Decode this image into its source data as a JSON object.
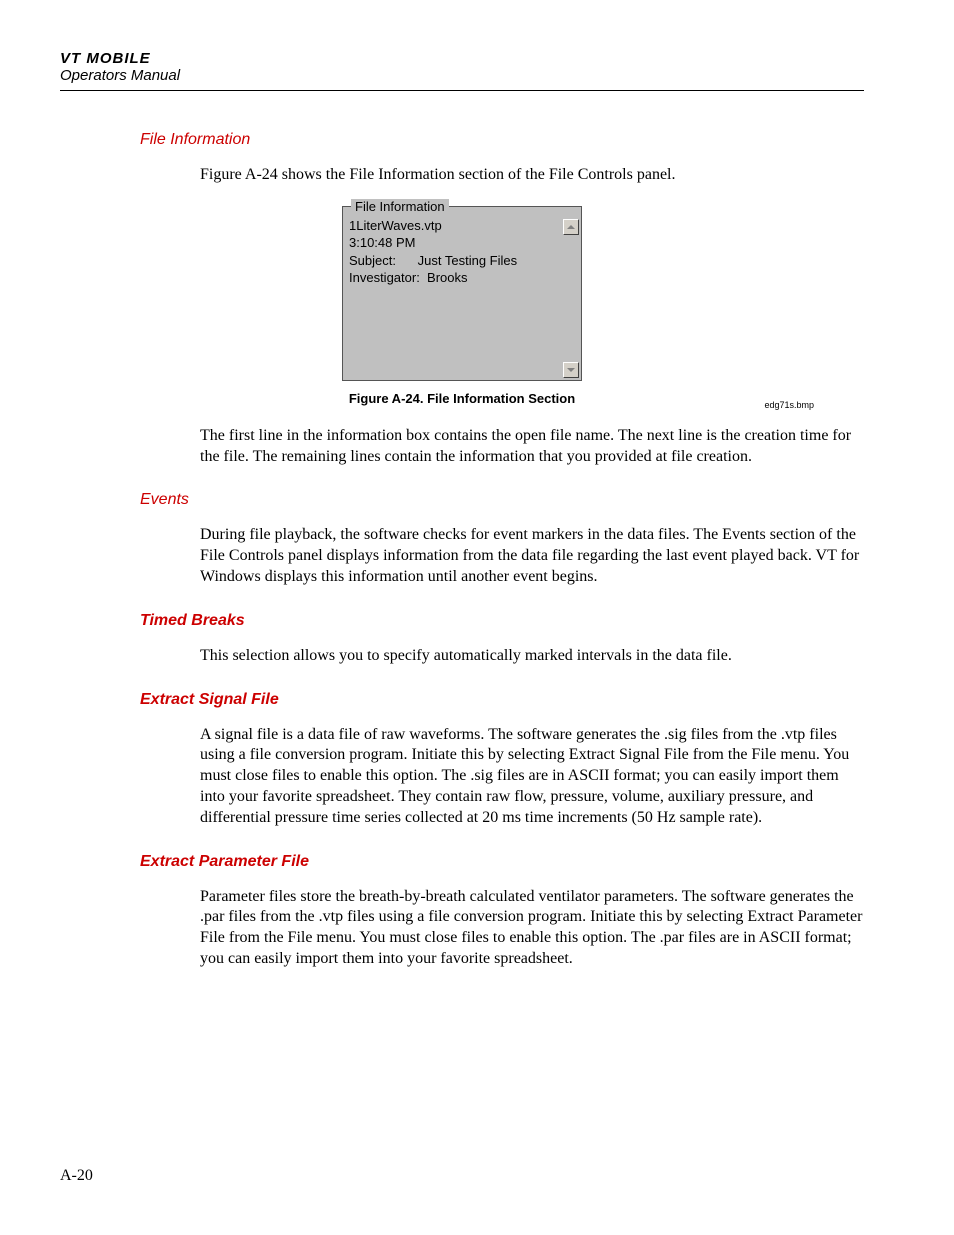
{
  "header": {
    "title": "VT MOBILE",
    "subtitle": "Operators Manual"
  },
  "sections": {
    "file_info": {
      "heading": "File Information",
      "intro": "Figure A-24 shows the File Information section of the File Controls panel.",
      "body": "The first line in the information box contains the open file name. The next line is the creation time for the file. The remaining lines contain the information that you provided at file creation."
    },
    "events": {
      "heading": "Events",
      "body": "During file playback, the software checks for event markers in the data files. The Events section of the File Controls panel displays information from the data file regarding the last event played back. VT for Windows displays this information until another event begins."
    },
    "timed_breaks": {
      "heading": "Timed Breaks",
      "body": "This selection allows you to specify automatically marked intervals in the data file."
    },
    "extract_signal": {
      "heading": "Extract Signal File",
      "body": "A signal file is a data file of raw waveforms. The software generates the .sig files from the .vtp files using a file conversion program. Initiate this by selecting Extract Signal File from the File menu. You must close files to enable this option. The .sig files are in ASCII format; you can easily import them into your favorite spreadsheet. They contain raw flow, pressure, volume, auxiliary pressure, and differential pressure time series collected at 20 ms time increments (50 Hz sample rate)."
    },
    "extract_param": {
      "heading": "Extract Parameter File",
      "body": "Parameter files store the breath-by-breath calculated ventilator parameters. The software generates the .par files from the .vtp files using a file conversion program. Initiate this by selecting Extract Parameter File from the File menu. You must close files to enable this option. The .par files are in ASCII format; you can easily import them into your favorite spreadsheet."
    }
  },
  "figure": {
    "legend": "File Information",
    "lines": {
      "l1": "1LiterWaves.vtp",
      "l2": "3:10:48 PM",
      "l3": "Subject:      Just Testing Files",
      "l4": "Investigator:  Brooks"
    },
    "caption": "Figure A-24. File Information Section",
    "bmp": "edg71s.bmp"
  },
  "page_number": "A-20"
}
